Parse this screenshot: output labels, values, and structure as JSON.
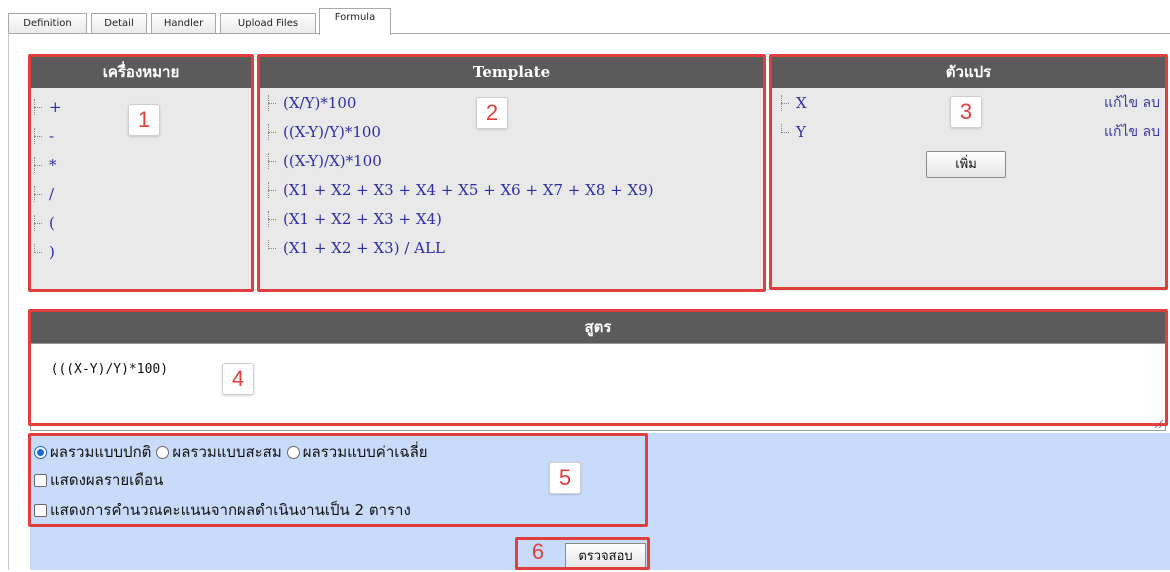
{
  "tabs": [
    {
      "label": "Definition"
    },
    {
      "label": "Detail"
    },
    {
      "label": "Handler"
    },
    {
      "label": "Upload Files"
    },
    {
      "label": "Formula"
    }
  ],
  "active_tab": "Formula",
  "symbols": {
    "title": "เครื่องหมาย",
    "items": [
      "+",
      "-",
      "*",
      "/",
      "(",
      ")"
    ]
  },
  "templates": {
    "title": "Template",
    "items": [
      "(X/Y)*100",
      "((X-Y)/Y)*100",
      "((X-Y)/X)*100",
      "(X1 + X2 + X3 + X4 + X5 + X6 + X7 + X8 + X9)",
      "(X1 + X2 + X3 + X4)",
      "(X1 + X2 + X3) / ALL"
    ]
  },
  "variables": {
    "title": "ตัวแปร",
    "items": [
      {
        "name": "X",
        "edit": "แก้ไข",
        "delete": "ลบ"
      },
      {
        "name": "Y",
        "edit": "แก้ไข",
        "delete": "ลบ"
      }
    ],
    "add_label": "เพิ่ม"
  },
  "formula": {
    "title": "สูตร",
    "value": "(((X-Y)/Y)*100)"
  },
  "options": {
    "sum_modes": [
      {
        "label": "ผลรวมแบบปกติ",
        "checked": true
      },
      {
        "label": "ผลรวมแบบสะสม",
        "checked": false
      },
      {
        "label": "ผลรวมแบบค่าเฉลี่ย",
        "checked": false
      }
    ],
    "show_monthly": "แสดงผลรายเดือน",
    "show_calc_two_tables": "แสดงการคำนวณคะแนนจากผลดำเนินงานเป็น 2 ตาราง"
  },
  "check_button": "ตรวจสอบ",
  "annotations": [
    "1",
    "2",
    "3",
    "4",
    "5",
    "6"
  ],
  "colors": {
    "header_bg": "#5b5b5b",
    "panel_bg": "#e9e9e9",
    "link": "#2e2ea8",
    "highlight_box": "#e0403d",
    "options_bg": "#c9dbfb"
  }
}
